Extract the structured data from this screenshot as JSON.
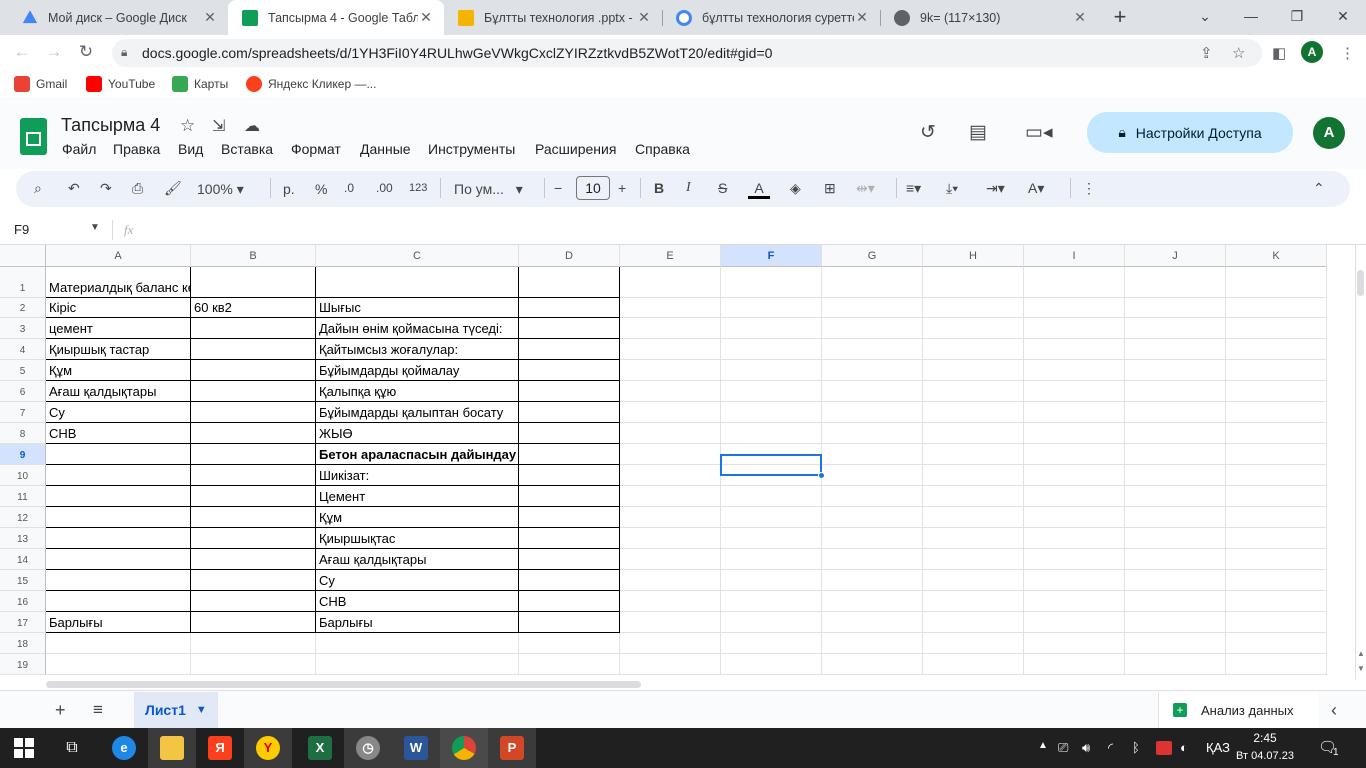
{
  "browser": {
    "tabs": [
      {
        "title": "Мой диск – Google Диск",
        "icon": "google-drive-icon",
        "color": "#4285f4"
      },
      {
        "title": "Тапсырма 4 - Google Табли",
        "icon": "google-sheets-icon",
        "color": "#0f9d58"
      },
      {
        "title": "Бұлтты технология .pptx - G",
        "icon": "google-slides-icon",
        "color": "#f4b400"
      },
      {
        "title": "бұлтты технология суреттер",
        "icon": "google-search-icon",
        "color": "#4285f4"
      },
      {
        "title": "9k= (117×130)",
        "icon": "globe-icon",
        "color": "#5f6368"
      }
    ],
    "active_tab": 1,
    "url": "docs.google.com/spreadsheets/d/1YH3FiI0Y4RULhwGeVWkgCxclZYIRZztkvdB5ZWotT20/edit#gid=0",
    "profile_initial": "A",
    "bookmarks": [
      {
        "label": "Gmail",
        "icon": "gmail-icon",
        "color": "#ea4335"
      },
      {
        "label": "YouTube",
        "icon": "youtube-icon",
        "color": "#ff0000"
      },
      {
        "label": "Карты",
        "icon": "maps-icon",
        "color": "#34a853"
      },
      {
        "label": "Яндекс Кликер —...",
        "icon": "yandex-icon",
        "color": "#fc3f1d"
      }
    ]
  },
  "sheets": {
    "doc_title": "Тапсырма 4",
    "menu": [
      "Файл",
      "Правка",
      "Вид",
      "Вставка",
      "Формат",
      "Данные",
      "Инструменты",
      "Расширения",
      "Справка"
    ],
    "share_label": "Настройки Доступа",
    "account_initial": "A",
    "toolbar": {
      "zoom": "100%",
      "currency": "р.",
      "percent": "%",
      "dec_decrease": ".0",
      "dec_increase": ".00",
      "number_format": "123",
      "font": "По ум...",
      "font_size": "10"
    },
    "name_box": "F9",
    "fx": "fx",
    "columns": [
      "A",
      "B",
      "C",
      "D",
      "E",
      "F",
      "G",
      "H",
      "I",
      "J",
      "K"
    ],
    "selected_column": "F",
    "selected_row": 9,
    "rows": [
      {
        "n": "1",
        "a": "Материалдық баланс кестесі",
        "b": "",
        "c": "",
        "d": ""
      },
      {
        "n": "2",
        "a": "Кіріс",
        "b": "60 кв2",
        "c": "Шығыс",
        "d": ""
      },
      {
        "n": "3",
        "a": "цемент",
        "b": "",
        "c": "Дайын өнім қоймасына түседі:",
        "d": ""
      },
      {
        "n": "4",
        "a": "Қиыршық тастар",
        "b": "",
        "c": "Қайтымсыз жоғалулар:",
        "d": ""
      },
      {
        "n": "5",
        "a": "Құм",
        "b": "",
        "c": "Бұйымдарды қоймалау",
        "d": ""
      },
      {
        "n": "6",
        "a": "Ағаш қалдықтары",
        "b": "",
        "c": "Қалыпқа құю",
        "d": ""
      },
      {
        "n": "7",
        "a": "Су",
        "b": "",
        "c": "Бұйымдарды қалыптан босату",
        "d": ""
      },
      {
        "n": "8",
        "a": "СНВ",
        "b": "",
        "c": "ЖЫӨ",
        "d": ""
      },
      {
        "n": "9",
        "a": "",
        "b": "",
        "c": "Бетон араласпасын дайындау",
        "d": ""
      },
      {
        "n": "10",
        "a": "",
        "b": "",
        "c": "Шикізат:",
        "d": ""
      },
      {
        "n": "11",
        "a": "",
        "b": "",
        "c": "Цемент",
        "d": ""
      },
      {
        "n": "12",
        "a": "",
        "b": "",
        "c": "Құм",
        "d": ""
      },
      {
        "n": "13",
        "a": "",
        "b": "",
        "c": "Қиыршықтас",
        "d": ""
      },
      {
        "n": "14",
        "a": "",
        "b": "",
        "c": "Ағаш қалдықтары",
        "d": ""
      },
      {
        "n": "15",
        "a": "",
        "b": "",
        "c": "Су",
        "d": ""
      },
      {
        "n": "16",
        "a": "",
        "b": "",
        "c": "СНВ",
        "d": ""
      },
      {
        "n": "17",
        "a": " Барлығы",
        "b": "",
        "c": " Барлығы",
        "d": ""
      },
      {
        "n": "18",
        "a": "",
        "b": "",
        "c": "",
        "d": ""
      },
      {
        "n": "19",
        "a": "",
        "b": "",
        "c": "",
        "d": ""
      }
    ],
    "sheet_tab": "Лист1",
    "explore_label": "Анализ данных"
  },
  "taskbar": {
    "apps": [
      {
        "icon": "windows-start-icon"
      },
      {
        "icon": "task-view-icon"
      },
      {
        "icon": "edge-icon",
        "color": "#1e88e5"
      },
      {
        "icon": "file-explorer-icon",
        "color": "#f4c542"
      },
      {
        "icon": "yandex-browser-icon",
        "color": "#fc3f1d"
      },
      {
        "icon": "yandex-icon",
        "color": "#ffcc00"
      },
      {
        "icon": "excel-icon",
        "color": "#1d6f42"
      },
      {
        "icon": "clock-app-icon",
        "color": "#888888"
      },
      {
        "icon": "word-icon",
        "color": "#2b579a"
      },
      {
        "icon": "chrome-icon",
        "color": "#4285f4"
      },
      {
        "icon": "powerpoint-icon",
        "color": "#d24726"
      }
    ],
    "language": "ҚАЗ",
    "time": "2:45",
    "date": "Вт 04.07.23",
    "notifications": "1"
  }
}
